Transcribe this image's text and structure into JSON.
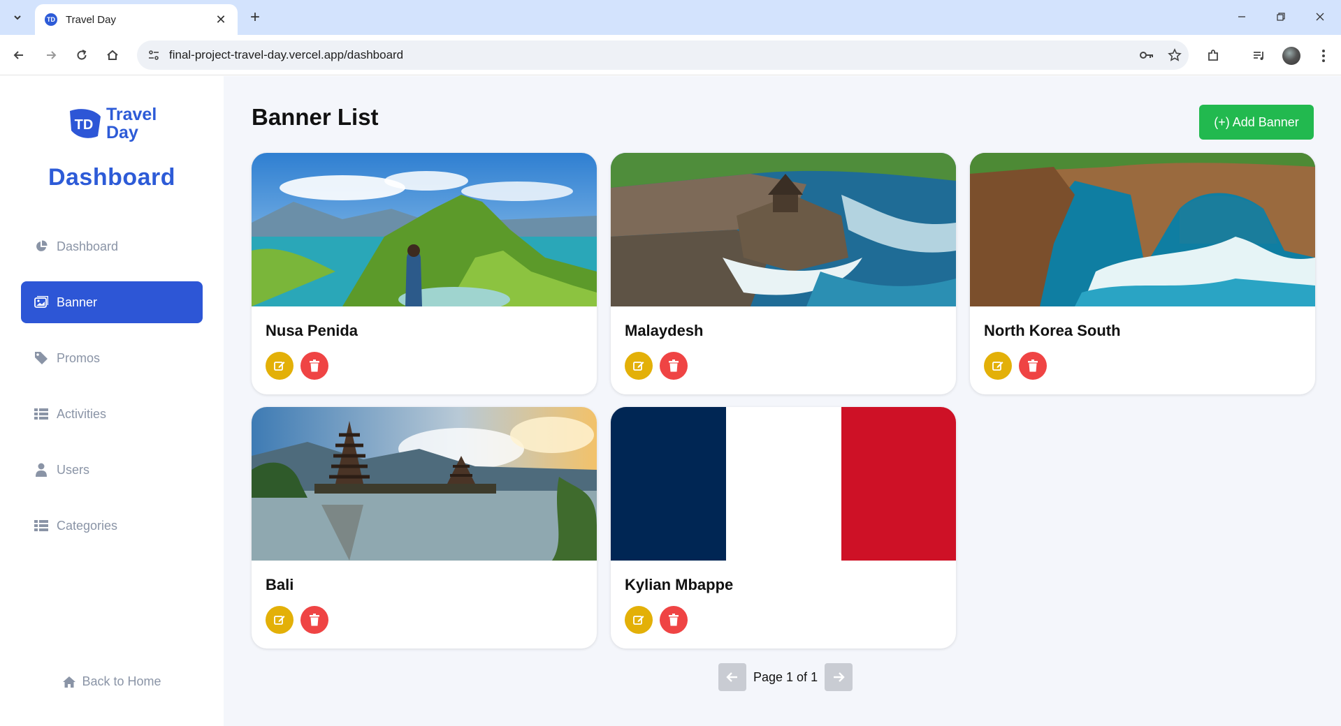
{
  "browser": {
    "tab_title": "Travel Day",
    "url": "final-project-travel-day.vercel.app/dashboard"
  },
  "sidebar": {
    "logo_text": [
      "Travel",
      "Day"
    ],
    "logo_mark": "TD",
    "title": "Dashboard",
    "items": [
      {
        "label": "Dashboard",
        "icon": "pie-chart-icon",
        "active": false
      },
      {
        "label": "Banner",
        "icon": "image-icon",
        "active": true
      },
      {
        "label": "Promos",
        "icon": "tag-icon",
        "active": false
      },
      {
        "label": "Activities",
        "icon": "list-icon",
        "active": false
      },
      {
        "label": "Users",
        "icon": "user-icon",
        "active": false
      },
      {
        "label": "Categories",
        "icon": "list-icon",
        "active": false
      }
    ],
    "back_home": "Back to Home"
  },
  "main": {
    "title": "Banner List",
    "add_button": "(+) Add Banner",
    "banners": [
      {
        "title": "Nusa Penida",
        "image": "green-hills-coast-image"
      },
      {
        "title": "Malaydesh",
        "image": "sea-temple-coast-image"
      },
      {
        "title": "North Korea South",
        "image": "rock-arch-waves-image"
      },
      {
        "title": "Bali",
        "image": "lake-temple-pagoda-image"
      },
      {
        "title": "Kylian Mbappe",
        "image": "french-flag-image"
      }
    ],
    "pagination": {
      "text": "Page 1 of 1"
    }
  },
  "colors": {
    "primary": "#2d56d6",
    "add_button": "#22b94f",
    "edit": "#e3b008",
    "delete": "#ef4444",
    "background": "#f4f6fb"
  }
}
